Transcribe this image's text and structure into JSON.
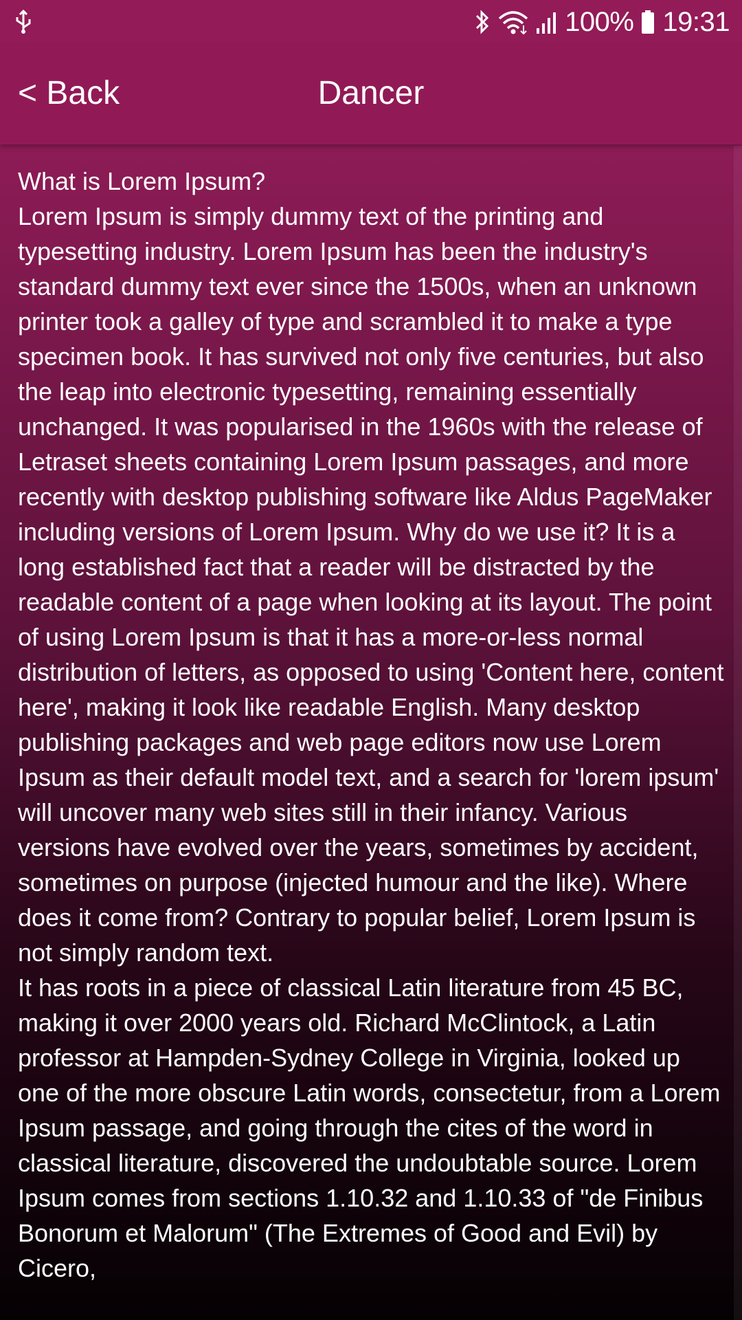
{
  "status_bar": {
    "icons": [
      "usb-icon",
      "bluetooth-icon",
      "wifi-icon",
      "signal-icon",
      "battery-icon"
    ],
    "battery_percent": "100%",
    "time": "19:31"
  },
  "app_bar": {
    "back_label": "< Back",
    "title": "Dancer"
  },
  "content": {
    "text": "What is Lorem Ipsum?\n Lorem Ipsum is simply dummy text of the printing and typesetting industry. Lorem Ipsum has been the industry's standard dummy text ever since the 1500s, when an unknown printer took a galley of type and scrambled it to make a type specimen book. It has survived not only five centuries, but also the leap into electronic typesetting, remaining essentially unchanged. It was popularised in the 1960s with the release of Letraset sheets containing Lorem Ipsum passages, and more recently with desktop publishing software like Aldus PageMaker including versions of Lorem Ipsum. Why do we use it? It is a long established fact that a reader will be distracted by the readable content of a page when looking at its layout. The point of using Lorem Ipsum is that it has a more-or-less normal distribution of letters, as opposed to using 'Content here, content here', making it look like readable English. Many desktop publishing packages and web page editors now use Lorem Ipsum as their default model text, and a search for 'lorem ipsum' will uncover many web sites still in their infancy. Various versions have evolved over the years, sometimes by accident, sometimes on purpose (injected humour and the like). Where does it come from? Contrary to popular belief, Lorem Ipsum is not simply random text.\n It has roots in a piece of classical Latin literature from 45 BC, making it over 2000 years old. Richard McClintock, a Latin professor at Hampden-Sydney College in Virginia, looked up one of the more obscure Latin words, consectetur, from a Lorem Ipsum passage, and going through the cites of the word in classical literature, discovered the undoubtable source. Lorem Ipsum comes from sections 1.10.32 and 1.10.33 of \"de Finibus Bonorum et Malorum\" (The Extremes of Good and Evil) by Cicero,"
  },
  "colors": {
    "app_bar": "#911a56",
    "status_bar": "#931b58",
    "gradient_top": "#9a1f5e",
    "gradient_bottom": "#050103",
    "text": "#ffffff"
  }
}
